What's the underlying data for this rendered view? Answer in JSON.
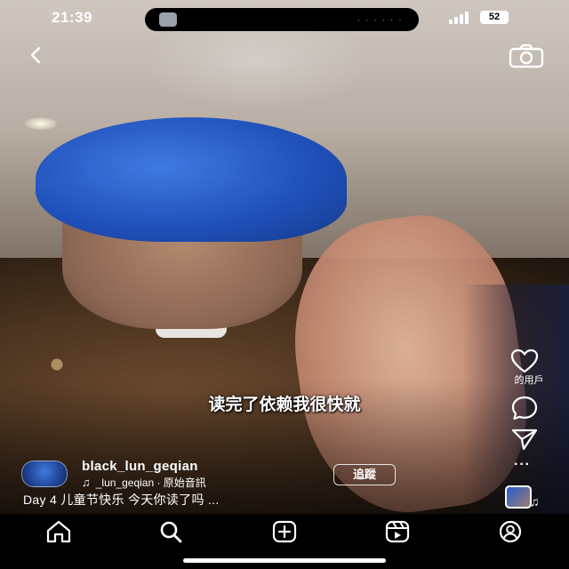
{
  "status_bar": {
    "time": "21:39",
    "island_dots": "· · · · · ·",
    "battery": "52"
  },
  "subtitle": "读完了依赖我很快就",
  "actions": {
    "like_label": "的用戶",
    "more": "···"
  },
  "author": {
    "username": "black_lun_geqian",
    "audio_text": "_lun_geqian · 原始音訊",
    "follow_label": "追蹤"
  },
  "caption": "Day 4 儿童节快乐 今天你读了吗 ...",
  "icons": {
    "back": "chevron-left-icon",
    "camera": "camera-icon",
    "like": "heart-icon",
    "comment": "comment-icon",
    "share": "send-icon",
    "home": "home-icon",
    "search": "search-icon",
    "create": "add-icon",
    "reels": "reels-icon",
    "profile": "profile-icon"
  },
  "colors": {
    "hair_blue": "#2e62cc",
    "background": "#000000",
    "text": "#ffffff"
  }
}
